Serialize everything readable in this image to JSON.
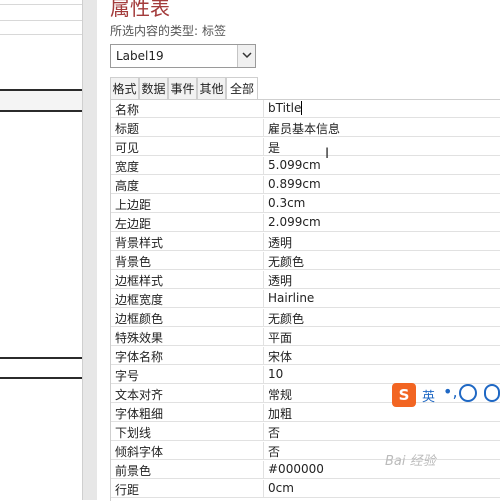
{
  "sheet": {
    "title": "属性表",
    "type_prefix": "所选内容的类型:",
    "type_value": "标签",
    "selected_control": "Label19"
  },
  "tabs": [
    {
      "label": "格式",
      "active": false
    },
    {
      "label": "数据",
      "active": false
    },
    {
      "label": "事件",
      "active": false
    },
    {
      "label": "其他",
      "active": false
    },
    {
      "label": "全部",
      "active": true
    }
  ],
  "properties": [
    {
      "name": "名称",
      "value": "bTitle"
    },
    {
      "name": "标题",
      "value": "雇员基本信息"
    },
    {
      "name": "可见",
      "value": "是"
    },
    {
      "name": "宽度",
      "value": "5.099cm"
    },
    {
      "name": "高度",
      "value": "0.899cm"
    },
    {
      "name": "上边距",
      "value": "0.3cm"
    },
    {
      "name": "左边距",
      "value": "2.099cm"
    },
    {
      "name": "背景样式",
      "value": "透明"
    },
    {
      "name": "背景色",
      "value": "无颜色"
    },
    {
      "name": "边框样式",
      "value": "透明"
    },
    {
      "name": "边框宽度",
      "value": "Hairline"
    },
    {
      "name": "边框颜色",
      "value": "无颜色"
    },
    {
      "name": "特殊效果",
      "value": "平面"
    },
    {
      "name": "字体名称",
      "value": "宋体"
    },
    {
      "name": "字号",
      "value": "10"
    },
    {
      "name": "文本对齐",
      "value": "常规"
    },
    {
      "name": "字体粗细",
      "value": "加粗"
    },
    {
      "name": "下划线",
      "value": "否"
    },
    {
      "name": "倾斜字体",
      "value": "否"
    },
    {
      "name": "前景色",
      "value": "#000000"
    },
    {
      "name": "行距",
      "value": "0cm"
    }
  ],
  "ime": {
    "logo": "S",
    "lang": "英",
    "dot": "•,",
    "icons": [
      "emoji-icon",
      "microphone-icon"
    ]
  },
  "watermark": "Bai 经验",
  "colors": {
    "title": "#a33b3b",
    "ime_accent": "#1f68c4",
    "ime_logo": "#f26522"
  }
}
